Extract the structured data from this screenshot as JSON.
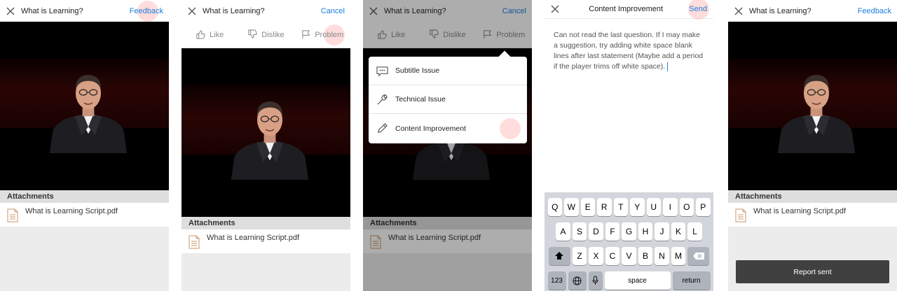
{
  "screens": [
    {
      "title": "What is Learning?",
      "action": "Feedback",
      "attachments_label": "Attachments",
      "attachment_file": "What is Learning Script.pdf"
    },
    {
      "title": "What is Learning?",
      "action": "Cancel",
      "reactions": {
        "like": "Like",
        "dislike": "Dislike",
        "problem": "Problem"
      },
      "attachments_label": "Attachments",
      "attachment_file": "What is Learning Script.pdf"
    },
    {
      "title": "What is Learning?",
      "action": "Cancel",
      "reactions": {
        "like": "Like",
        "dislike": "Dislike",
        "problem": "Problem"
      },
      "menu": [
        "Subtitle Issue",
        "Technical Issue",
        "Content Improvement"
      ],
      "attachments_label": "Attachments",
      "attachment_file": "What is Learning Script.pdf"
    },
    {
      "title": "Content Improvement",
      "action": "Send",
      "message": "Can not read the last question. If I may make a suggestion, try adding white space blank lines after last statement (Maybe add a period if the player trims off white space).",
      "keyboard": {
        "row1": [
          "Q",
          "W",
          "E",
          "R",
          "T",
          "Y",
          "U",
          "I",
          "O",
          "P"
        ],
        "row2": [
          "A",
          "S",
          "D",
          "F",
          "G",
          "H",
          "J",
          "K",
          "L"
        ],
        "row3": [
          "Z",
          "X",
          "C",
          "V",
          "B",
          "N",
          "M"
        ],
        "numbers": "123",
        "space": "space",
        "return": "return"
      }
    },
    {
      "title": "What is Learning?",
      "action": "Feedback",
      "attachments_label": "Attachments",
      "attachment_file": "What is Learning Script.pdf",
      "toast": "Report sent"
    }
  ],
  "colors": {
    "link": "#1a7fe0",
    "tap_highlight": "#ff9696",
    "attachments_bar": "#dedede",
    "toast": "#404040"
  },
  "icons": [
    "close-icon",
    "thumbs-up-icon",
    "thumbs-down-icon",
    "flag-icon",
    "subtitle-icon",
    "wrench-icon",
    "pencil-icon",
    "pdf-file-icon",
    "shift-icon",
    "backspace-icon",
    "globe-icon",
    "microphone-icon"
  ]
}
